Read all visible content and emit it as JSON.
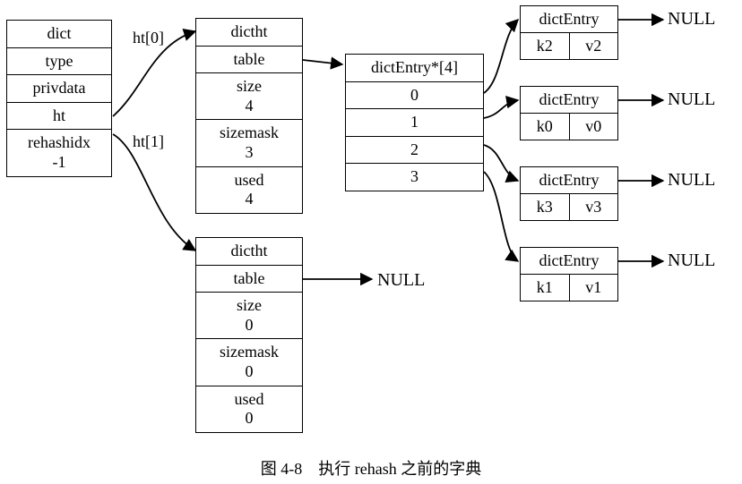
{
  "dict": {
    "title": "dict",
    "fields": [
      "type",
      "privdata",
      "ht"
    ],
    "rehashidx_label": "rehashidx",
    "rehashidx_value": "-1"
  },
  "edge_labels": {
    "ht0": "ht[0]",
    "ht1": "ht[1]"
  },
  "dictht0": {
    "title": "dictht",
    "table_label": "table",
    "rows": [
      {
        "label": "size",
        "value": "4"
      },
      {
        "label": "sizemask",
        "value": "3"
      },
      {
        "label": "used",
        "value": "4"
      }
    ]
  },
  "dictht1": {
    "title": "dictht",
    "table_label": "table",
    "rows": [
      {
        "label": "size",
        "value": "0"
      },
      {
        "label": "sizemask",
        "value": "0"
      },
      {
        "label": "used",
        "value": "0"
      }
    ]
  },
  "array": {
    "title": "dictEntry*[4]",
    "indices": [
      "0",
      "1",
      "2",
      "3"
    ]
  },
  "entries": [
    {
      "title": "dictEntry",
      "k": "k2",
      "v": "v2"
    },
    {
      "title": "dictEntry",
      "k": "k0",
      "v": "v0"
    },
    {
      "title": "dictEntry",
      "k": "k3",
      "v": "v3"
    },
    {
      "title": "dictEntry",
      "k": "k1",
      "v": "v1"
    }
  ],
  "null_text": "NULL",
  "caption": "图 4-8　执行 rehash 之前的字典"
}
